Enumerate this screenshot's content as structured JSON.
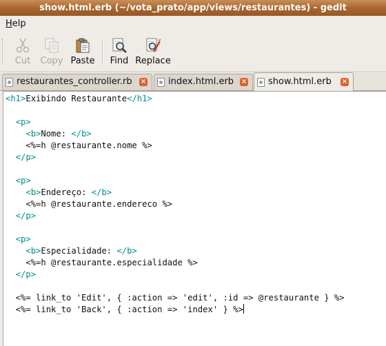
{
  "window": {
    "title": "show.html.erb (~/vota_prato/app/views/restaurantes) - gedit"
  },
  "menubar": {
    "items": [
      {
        "label": "Help"
      }
    ]
  },
  "toolbar": {
    "cut": "Cut",
    "copy": "Copy",
    "paste": "Paste",
    "find": "Find",
    "replace": "Replace"
  },
  "tabs": [
    {
      "label": "restaurantes_controller.rb",
      "close": "×",
      "icon": "document-icon"
    },
    {
      "label": "index.html.erb",
      "close": "×",
      "icon": "document-icon"
    },
    {
      "label": "show.html.erb",
      "close": "×",
      "icon": "document-icon",
      "active": true
    }
  ],
  "editor": {
    "lines": [
      [
        [
          "t",
          "<h1>"
        ],
        [
          "n",
          "Exibindo Restaurante"
        ],
        [
          "t",
          "</h1>"
        ]
      ],
      [],
      [
        [
          "n",
          "  "
        ],
        [
          "t",
          "<p>"
        ]
      ],
      [
        [
          "n",
          "    "
        ],
        [
          "t",
          "<b>"
        ],
        [
          "n",
          "Nome: "
        ],
        [
          "t",
          "</b>"
        ]
      ],
      [
        [
          "n",
          "    <%=h @restaurante.nome %>"
        ]
      ],
      [
        [
          "n",
          "  "
        ],
        [
          "t",
          "</p>"
        ]
      ],
      [],
      [
        [
          "n",
          "  "
        ],
        [
          "t",
          "<p>"
        ]
      ],
      [
        [
          "n",
          "    "
        ],
        [
          "t",
          "<b>"
        ],
        [
          "n",
          "Endereço: "
        ],
        [
          "t",
          "</b>"
        ]
      ],
      [
        [
          "n",
          "    <%=h @restaurante.endereco %>"
        ]
      ],
      [
        [
          "n",
          "  "
        ],
        [
          "t",
          "</p>"
        ]
      ],
      [],
      [
        [
          "n",
          "  "
        ],
        [
          "t",
          "<p>"
        ]
      ],
      [
        [
          "n",
          "    "
        ],
        [
          "t",
          "<b>"
        ],
        [
          "n",
          "Especialidade: "
        ],
        [
          "t",
          "</b>"
        ]
      ],
      [
        [
          "n",
          "    <%=h @restaurante.especialidade %>"
        ]
      ],
      [
        [
          "n",
          "  "
        ],
        [
          "t",
          "</p>"
        ]
      ],
      [],
      [
        [
          "n",
          "  <%= link_to 'Edit', { :action => 'edit', :id => @restaurante } %>"
        ]
      ],
      [
        [
          "n",
          "  <%= link_to 'Back', { :action => 'index' } %>"
        ]
      ]
    ]
  },
  "colors": {
    "titlebar": "#a7642c",
    "tag": "#008a8c",
    "tab_close": "#e0612b"
  }
}
